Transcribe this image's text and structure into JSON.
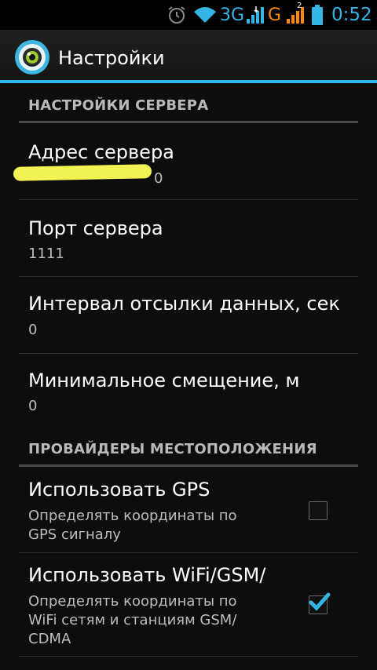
{
  "status_bar": {
    "network_3g": "3G",
    "network_g": "G",
    "sim2_label": "2",
    "time": "0:52",
    "icons": [
      "alarm-icon",
      "wifi-icon",
      "signal-icon",
      "battery-icon"
    ],
    "colors": {
      "accent": "#33b5e5",
      "g_color": "#ff8800"
    }
  },
  "action_bar": {
    "title": "Настройки",
    "icon": "app-eye-icon"
  },
  "sections": [
    {
      "title": "НАСТРОЙКИ СЕРВЕРА"
    },
    {
      "title": "ПРОВАЙДЕРЫ МЕСТОПОЛОЖЕНИЯ"
    }
  ],
  "preferences": {
    "server_address": {
      "title": "Адрес сервера",
      "summary": "0"
    },
    "server_port": {
      "title": "Порт сервера",
      "summary": "1111"
    },
    "send_interval": {
      "title": "Интервал отсылки данных, сек",
      "summary": "0"
    },
    "min_distance": {
      "title": "Минимальное смещение, м",
      "summary": "0"
    },
    "use_gps": {
      "title": "Использовать GPS",
      "summary": "Определять координаты по GPS сигналу",
      "checked": false
    },
    "use_wifi_gsm": {
      "title": "Использовать WiFi/GSM/",
      "summary": "Определять координаты по WiFi сетям и станциям GSM/ CDMA",
      "checked": true
    }
  }
}
